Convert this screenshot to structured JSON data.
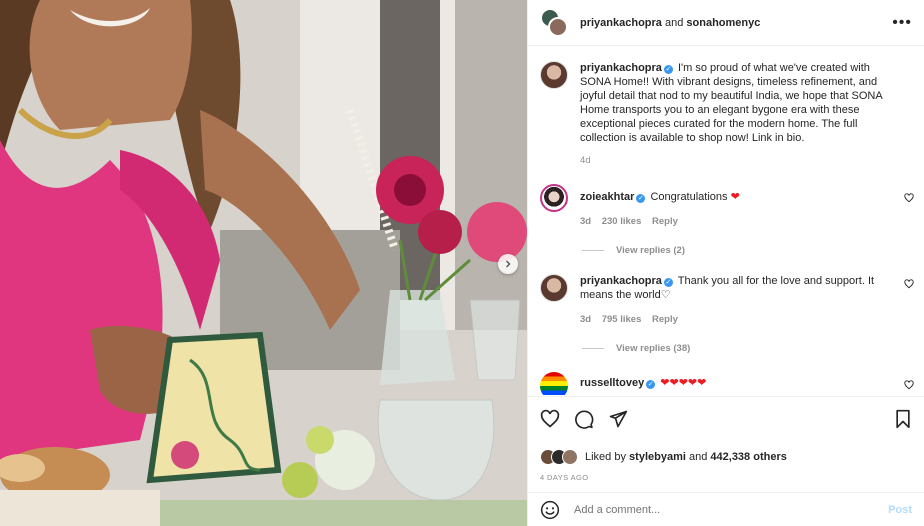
{
  "header": {
    "user1": "priyankachopra",
    "conjunction": "and",
    "user2": "sonahomenyc",
    "more_label": "•••"
  },
  "caption": {
    "username": "priyankachopra",
    "text": "I'm so proud of what we've created with SONA Home!! With vibrant designs, timeless refinement, and joyful detail that nod to my beautiful India, we hope that SONA Home transports you to an elegant bygone era with these exceptional pieces curated for the modern home. The full collection is available to shop now! Link in bio.",
    "time": "4d"
  },
  "comments": [
    {
      "username": "zoieakhtar",
      "text": "Congratulations",
      "hearts": "❤",
      "time": "3d",
      "likes": "230 likes",
      "reply_label": "Reply",
      "view_replies": "View replies (2)"
    },
    {
      "username": "priyankachopra",
      "text": "Thank you all for the love and support. It means the world",
      "hearts": "♡",
      "time": "3d",
      "likes": "795 likes",
      "reply_label": "Reply",
      "view_replies": "View replies (38)"
    },
    {
      "username": "russelltovey",
      "text": "",
      "hearts": "❤❤❤❤❤"
    }
  ],
  "likes": {
    "prefix": "Liked by",
    "user": "stylebyami",
    "middle": "and",
    "count": "442,338 others"
  },
  "post_date": "4 DAYS AGO",
  "add_comment": {
    "placeholder": "Add a comment...",
    "post_label": "Post"
  },
  "colors": {
    "verified": "#3897f0",
    "heart_red": "#ed1c24",
    "post_disabled": "#b3dbff"
  }
}
